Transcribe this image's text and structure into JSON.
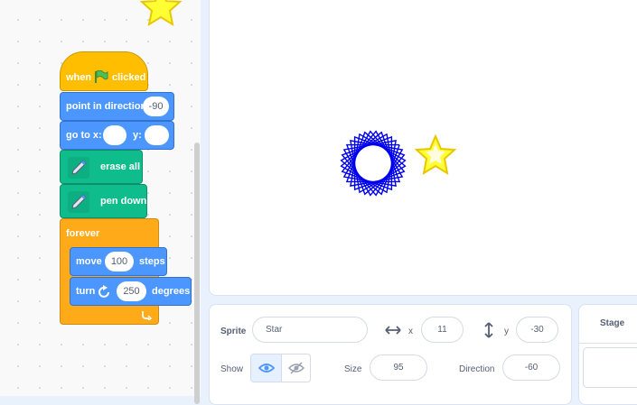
{
  "blocks": {
    "when_flag": {
      "when": "when",
      "clicked": "clicked"
    },
    "point_dir": {
      "label": "point in direction",
      "value": "-90"
    },
    "goto": {
      "label": "go to x:",
      "y_label": "y:",
      "x_value": "",
      "y_value": ""
    },
    "erase": {
      "label": "erase all"
    },
    "pen_down": {
      "label": "pen down"
    },
    "forever": {
      "label": "forever"
    },
    "move": {
      "label": "move",
      "value": "100",
      "unit": "steps"
    },
    "turn": {
      "label": "turn",
      "value": "250",
      "unit": "degrees"
    }
  },
  "sprite_info": {
    "sprite_label": "Sprite",
    "sprite_name": "Star",
    "x_label": "x",
    "x_value": "11",
    "y_label": "y",
    "y_value": "-30",
    "show_label": "Show",
    "size_label": "Size",
    "size_value": "95",
    "direction_label": "Direction",
    "direction_value": "-60"
  },
  "stage_panel": {
    "title": "Stage"
  },
  "colors": {
    "motion": "#4c97ff",
    "event": "#ffbf00",
    "pen": "#0fbd8c",
    "control": "#ffab19",
    "pen_trail": "#0000ee",
    "star": "#ffff33"
  },
  "icons": [
    "green-flag-icon",
    "pen-icon",
    "rotate-right-icon",
    "loop-arrow-icon",
    "star-sprite-icon",
    "arrows-horizontal-icon",
    "arrows-vertical-icon",
    "eye-icon",
    "eye-slash-icon"
  ]
}
